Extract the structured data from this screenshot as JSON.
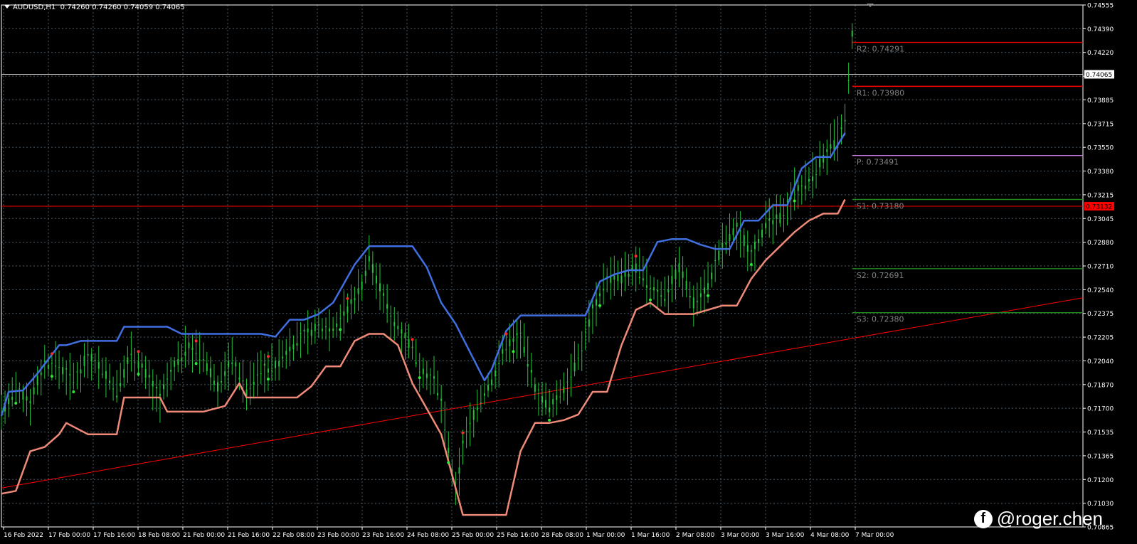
{
  "header": {
    "symbol_timeframe": "AUDUSD,H1",
    "ohlc": "0.74260 0.74260 0.74059 0.74065"
  },
  "watermark": {
    "icon": "facebook-icon",
    "text": "@roger.chen"
  },
  "colors": {
    "background": "#000000",
    "grid": "#4a5a66",
    "upper_band": "#3f6fe0",
    "lower_band": "#f08a78",
    "candles": "#23c23a",
    "resistance": "#ff0000",
    "pivot": "#cc77dd",
    "support": "#1f8a1f",
    "trendline": "#ff0000",
    "current_price_line": "#cccccc",
    "text": "#ffffff",
    "level_label": "#808080"
  },
  "chart_data": {
    "type": "line",
    "title": "AUDUSD,H1",
    "xlabel": "",
    "ylabel": "",
    "ylim": [
      0.70865,
      0.74555
    ],
    "grid": true,
    "y_ticks": [
      "0.74555",
      "0.74390",
      "0.74220",
      "0.74065",
      "0.73885",
      "0.73715",
      "0.73550",
      "0.73380",
      "0.73215",
      "0.73045",
      "0.72880",
      "0.72710",
      "0.72540",
      "0.72375",
      "0.72205",
      "0.72040",
      "0.71870",
      "0.71700",
      "0.71535",
      "0.71365",
      "0.71200",
      "0.71030",
      "0.70865"
    ],
    "x_ticks": [
      "16 Feb 2022",
      "17 Feb 00:00",
      "17 Feb 16:00",
      "18 Feb 08:00",
      "21 Feb 00:00",
      "21 Feb 16:00",
      "22 Feb 08:00",
      "23 Feb 00:00",
      "23 Feb 16:00",
      "24 Feb 08:00",
      "25 Feb 00:00",
      "25 Feb 16:00",
      "28 Feb 08:00",
      "1 Mar 00:00",
      "1 Mar 16:00",
      "2 Mar 08:00",
      "3 Mar 00:00",
      "3 Mar 16:00",
      "4 Mar 08:00",
      "7 Mar 00:00"
    ],
    "current_price": {
      "value": 0.74065,
      "label": "0.74065"
    },
    "trendline_price": {
      "value": 0.73132,
      "label": "0.73132"
    },
    "pivot_levels": [
      {
        "name": "R2",
        "value": 0.74291,
        "label": "R2: 0.74291",
        "color": "#ff0000"
      },
      {
        "name": "R1",
        "value": 0.7398,
        "label": "R1: 0.73980",
        "color": "#ff0000"
      },
      {
        "name": "P",
        "value": 0.73491,
        "label": "P: 0.73491",
        "color": "#cc77dd"
      },
      {
        "name": "S1",
        "value": 0.7318,
        "label": "S1: 0.73180",
        "color": "#1f8a1f"
      },
      {
        "name": "S2",
        "value": 0.72691,
        "label": "S2: 0.72691",
        "color": "#1f8a1f"
      },
      {
        "name": "S3",
        "value": 0.7238,
        "label": "S3: 0.72380",
        "color": "#1f8a1f"
      }
    ],
    "trendline": {
      "start": [
        0,
        0.7114
      ],
      "end": [
        150,
        0.72485
      ]
    },
    "series": [
      {
        "role": "upper",
        "x": [
          0,
          1,
          3,
          5,
          8,
          9,
          11,
          13,
          16,
          17,
          20,
          23,
          25,
          28,
          30,
          32,
          36,
          38,
          40,
          42,
          44,
          46,
          49,
          51,
          53,
          55,
          57,
          59,
          61,
          63,
          66,
          67,
          68,
          70,
          72,
          75,
          77,
          79,
          81,
          83,
          85,
          87,
          89,
          91,
          93,
          95,
          97,
          99,
          101,
          103,
          105,
          107,
          109,
          111,
          113,
          115,
          117
        ],
        "y": [
          0.7165,
          0.7182,
          0.7183,
          0.7195,
          0.7215,
          0.7215,
          0.7218,
          0.7218,
          0.7218,
          0.7228,
          0.7228,
          0.7228,
          0.7223,
          0.7223,
          0.7223,
          0.7223,
          0.7223,
          0.7221,
          0.7233,
          0.7233,
          0.7237,
          0.7245,
          0.7272,
          0.7285,
          0.7285,
          0.7285,
          0.7285,
          0.727,
          0.7245,
          0.723,
          0.72,
          0.719,
          0.7198,
          0.7225,
          0.7236,
          0.7236,
          0.7236,
          0.7236,
          0.7236,
          0.726,
          0.7265,
          0.7268,
          0.7268,
          0.7288,
          0.729,
          0.729,
          0.7286,
          0.7283,
          0.7283,
          0.7303,
          0.7303,
          0.7314,
          0.7314,
          0.734,
          0.7348,
          0.7348,
          0.7365
        ]
      },
      {
        "role": "lower",
        "x": [
          0,
          2,
          4,
          6,
          8,
          9,
          12,
          16,
          17,
          20,
          22,
          23,
          25,
          28,
          31,
          33,
          34,
          35,
          38,
          41,
          43,
          45,
          47,
          49,
          51,
          53,
          55,
          57,
          59,
          61,
          64,
          66,
          68,
          69,
          70,
          72,
          74,
          76,
          78,
          80,
          82,
          84,
          86,
          88,
          90,
          92,
          94,
          96,
          98,
          100,
          102,
          104,
          106,
          108,
          110,
          112,
          114,
          116,
          117
        ],
        "y": [
          0.711,
          0.7112,
          0.714,
          0.7143,
          0.7152,
          0.716,
          0.7152,
          0.7152,
          0.7178,
          0.7178,
          0.7178,
          0.7168,
          0.7168,
          0.7168,
          0.7172,
          0.7188,
          0.7178,
          0.7178,
          0.7178,
          0.7178,
          0.7186,
          0.72,
          0.72,
          0.7218,
          0.7223,
          0.7223,
          0.7215,
          0.7188,
          0.717,
          0.7152,
          0.7095,
          0.7095,
          0.7095,
          0.7095,
          0.7095,
          0.714,
          0.716,
          0.716,
          0.7162,
          0.7166,
          0.7182,
          0.7182,
          0.7215,
          0.724,
          0.7245,
          0.7237,
          0.7237,
          0.7237,
          0.724,
          0.7243,
          0.7243,
          0.7262,
          0.7275,
          0.7285,
          0.7295,
          0.7303,
          0.7308,
          0.7308,
          0.7318
        ]
      },
      {
        "role": "price",
        "x": [
          0,
          2,
          4,
          5,
          6,
          8,
          10,
          12,
          14,
          16,
          18,
          20,
          22,
          24,
          26,
          28,
          30,
          32,
          34,
          36,
          38,
          40,
          42,
          44,
          46,
          48,
          50,
          51,
          52,
          54,
          56,
          58,
          60,
          61,
          62,
          63,
          64,
          66,
          68,
          70,
          72,
          74,
          76,
          78,
          80,
          82,
          84,
          86,
          88,
          90,
          92,
          94,
          96,
          98,
          100,
          102,
          104,
          106,
          108,
          110,
          112,
          114,
          116,
          117,
          117.5,
          118
        ],
        "y": [
          0.7168,
          0.7182,
          0.7176,
          0.719,
          0.7202,
          0.72,
          0.719,
          0.7208,
          0.7198,
          0.7182,
          0.721,
          0.7195,
          0.7178,
          0.72,
          0.7215,
          0.7205,
          0.7186,
          0.7205,
          0.7182,
          0.7198,
          0.72,
          0.7214,
          0.7222,
          0.7228,
          0.7228,
          0.724,
          0.7258,
          0.7278,
          0.7262,
          0.7235,
          0.7222,
          0.72,
          0.719,
          0.7175,
          0.714,
          0.7108,
          0.7145,
          0.7172,
          0.719,
          0.7215,
          0.7222,
          0.7185,
          0.717,
          0.7185,
          0.7205,
          0.724,
          0.7262,
          0.7262,
          0.727,
          0.7255,
          0.725,
          0.727,
          0.7245,
          0.7258,
          0.7285,
          0.7298,
          0.728,
          0.73,
          0.7305,
          0.7325,
          0.733,
          0.7348,
          0.736,
          0.7372,
          0.74,
          0.7435
        ]
      }
    ],
    "markers": {
      "upper_dots_x": [
        2,
        7,
        10,
        19,
        27,
        37,
        47,
        58,
        62,
        71,
        76,
        83,
        90,
        98,
        104,
        110
      ],
      "lower_dots_x": [
        7,
        19,
        27,
        37,
        48,
        57,
        64,
        70,
        88
      ]
    }
  }
}
